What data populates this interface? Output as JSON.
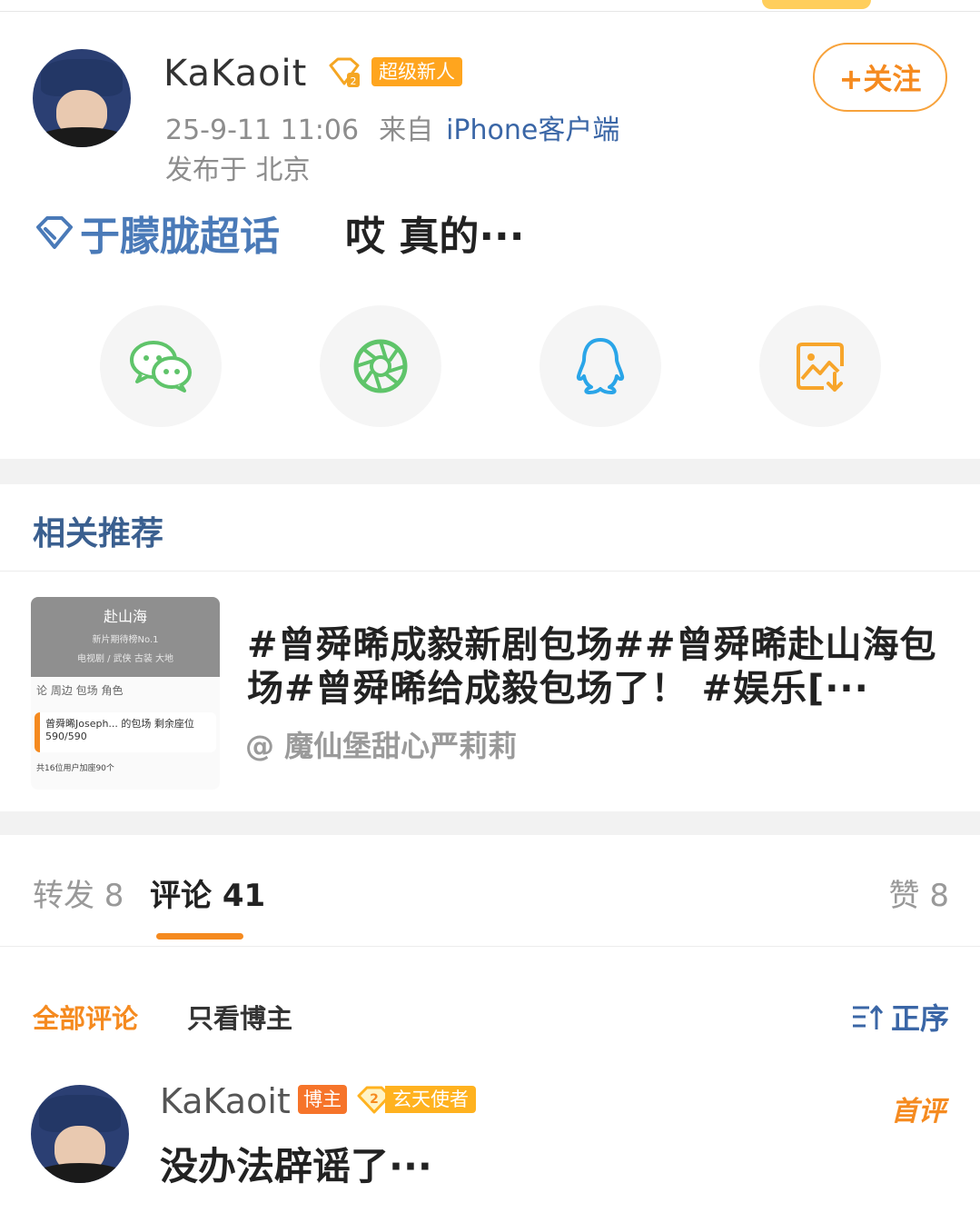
{
  "post": {
    "username": "KaKaoit",
    "badge": "超级新人",
    "follow_label": "+关注",
    "date": "25-9-11 11:06",
    "source_prefix": "来自",
    "source": "iPhone客户端",
    "location": "发布于 北京",
    "supertopic": "于朦胧超话",
    "text": "哎 真的···"
  },
  "share_icons": [
    "wechat-icon",
    "moments-icon",
    "qq-icon",
    "save-image-icon"
  ],
  "colors": {
    "accent_orange": "#f58a1f",
    "link_blue": "#3a66a6",
    "wechat_green": "#5fc46a",
    "qq_blue": "#2aa5e8",
    "save_orange": "#f7a52b"
  },
  "related": {
    "section_title": "相关推荐",
    "thumb_title": "赴山海",
    "thumb_subtitle": "新片期待榜No.1",
    "thumb_meta": "电视剧 / 武侠 古装 大地",
    "thumb_tabs": "论 周边 包场 角色",
    "thumb_card": "曾舜晞Joseph... 的包场 剩余座位590/590",
    "thumb_foot": "共16位用户加座90个",
    "title": "#曾舜晞成毅新剧包场##曾舜晞赴山海包场#曾舜晞给成毅包场了！ #娱乐[···",
    "author": "@ 魔仙堡甜心严莉莉"
  },
  "tabs": {
    "repost": "转发 8",
    "comment": "评论 41",
    "like": "赞 8"
  },
  "filters": {
    "all": "全部评论",
    "host_only": "只看博主",
    "sort": "正序"
  },
  "comment": {
    "username": "KaKaoit",
    "host_badge": "博主",
    "rank_number": "2",
    "rank_badge": "玄天使者",
    "first_label": "首评",
    "text": "没办法辟谣了···"
  }
}
